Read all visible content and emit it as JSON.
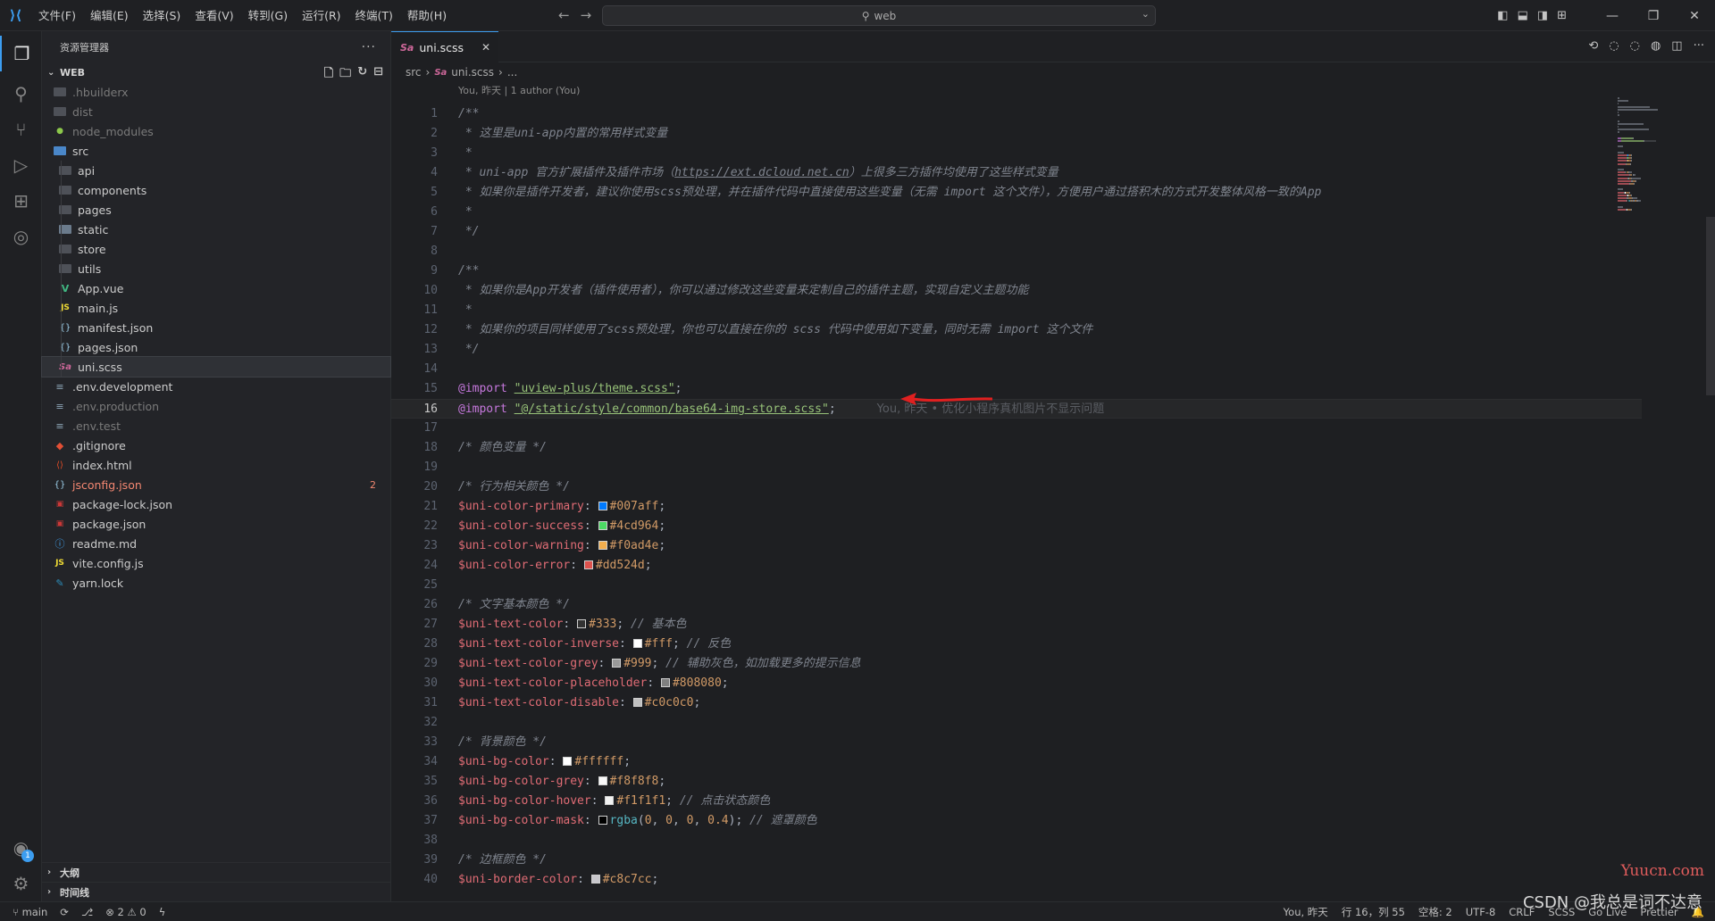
{
  "menu": [
    "文件(F)",
    "编辑(E)",
    "选择(S)",
    "查看(V)",
    "转到(G)",
    "运行(R)",
    "终端(T)",
    "帮助(H)"
  ],
  "command_center": "web",
  "sidebar": {
    "title": "资源管理器",
    "workspace": "WEB",
    "tree": [
      {
        "name": ".hbuilderx",
        "icon": "folder",
        "depth": 0,
        "dim": true
      },
      {
        "name": "dist",
        "icon": "folder",
        "depth": 0,
        "dim": true
      },
      {
        "name": "node_modules",
        "icon": "folder-node",
        "depth": 0,
        "dim": true
      },
      {
        "name": "src",
        "icon": "folder-open-src",
        "depth": 0
      },
      {
        "name": "api",
        "icon": "folder",
        "depth": 1
      },
      {
        "name": "components",
        "icon": "folder",
        "depth": 1
      },
      {
        "name": "pages",
        "icon": "folder",
        "depth": 1
      },
      {
        "name": "static",
        "icon": "folder-static",
        "depth": 1
      },
      {
        "name": "store",
        "icon": "folder",
        "depth": 1
      },
      {
        "name": "utils",
        "icon": "folder",
        "depth": 1
      },
      {
        "name": "App.vue",
        "icon": "vue-icon",
        "depth": 1
      },
      {
        "name": "main.js",
        "icon": "js-icon",
        "depth": 1
      },
      {
        "name": "manifest.json",
        "icon": "json-icon",
        "depth": 1
      },
      {
        "name": "pages.json",
        "icon": "json-icon",
        "depth": 1
      },
      {
        "name": "uni.scss",
        "icon": "sass-icon",
        "depth": 1,
        "selected": true
      },
      {
        "name": ".env.development",
        "icon": "env-icon",
        "depth": 0
      },
      {
        "name": ".env.production",
        "icon": "env-icon",
        "depth": 0,
        "dim": true
      },
      {
        "name": ".env.test",
        "icon": "env-icon",
        "depth": 0,
        "dim": true
      },
      {
        "name": ".gitignore",
        "icon": "git-icon",
        "depth": 0
      },
      {
        "name": "index.html",
        "icon": "html-icon",
        "depth": 0
      },
      {
        "name": "jsconfig.json",
        "icon": "json-icon",
        "depth": 0,
        "red": true,
        "badge": "2"
      },
      {
        "name": "package-lock.json",
        "icon": "npm-icon",
        "depth": 0
      },
      {
        "name": "package.json",
        "icon": "npm-icon",
        "depth": 0
      },
      {
        "name": "readme.md",
        "icon": "info-icon",
        "depth": 0
      },
      {
        "name": "vite.config.js",
        "icon": "js-icon",
        "depth": 0
      },
      {
        "name": "yarn.lock",
        "icon": "yarn-icon",
        "depth": 0
      }
    ],
    "outline_label": "大纲",
    "timeline_label": "时间线"
  },
  "editor": {
    "tab_label": "uni.scss",
    "breadcrumb": [
      "src",
      "uni.scss",
      "..."
    ],
    "blame_header": "You, 昨天 | 1 author (You)",
    "inline_blame": "You, 昨天 • 优化小程序真机图片不显示问题",
    "current_line": 16
  },
  "colors": {
    "primary": "#007aff",
    "success": "#4cd964",
    "warning": "#f0ad4e",
    "error": "#dd524d",
    "text": "#333",
    "inverse": "#fff",
    "grey": "#999",
    "placeholder": "#808080",
    "disable": "#c0c0c0",
    "bg": "#ffffff",
    "bg_grey": "#f8f8f8",
    "bg_hover": "#f1f1f1",
    "bg_mask": "#000000",
    "border": "#c8c7cc"
  },
  "code_lines": [
    [
      {
        "c": "t-comment",
        "t": "/**"
      }
    ],
    [
      {
        "c": "t-comment",
        "t": " * 这里是uni-app内置的常用样式变量"
      }
    ],
    [
      {
        "c": "t-comment",
        "t": " *"
      }
    ],
    [
      {
        "c": "t-comment",
        "t": " * uni-app 官方扩展插件及插件市场（"
      },
      {
        "c": "t-link",
        "t": "https://ext.dcloud.net.cn"
      },
      {
        "c": "t-comment",
        "t": "）上很多三方插件均使用了这些样式变量"
      }
    ],
    [
      {
        "c": "t-comment",
        "t": " * 如果你是插件开发者，建议你使用scss预处理，并在插件代码中直接使用这些变量（无需 import 这个文件），方便用户通过搭积木的方式开发整体风格一致的App"
      }
    ],
    [
      {
        "c": "t-comment",
        "t": " *"
      }
    ],
    [
      {
        "c": "t-comment",
        "t": " */"
      }
    ],
    [],
    [
      {
        "c": "t-comment",
        "t": "/**"
      }
    ],
    [
      {
        "c": "t-comment",
        "t": " * 如果你是App开发者（插件使用者），你可以通过修改这些变量来定制自己的插件主题，实现自定义主题功能"
      }
    ],
    [
      {
        "c": "t-comment",
        "t": " *"
      }
    ],
    [
      {
        "c": "t-comment",
        "t": " * 如果你的项目同样使用了scss预处理，你也可以直接在你的 scss 代码中使用如下变量，同时无需 import 这个文件"
      }
    ],
    [
      {
        "c": "t-comment",
        "t": " */"
      }
    ],
    [],
    [
      {
        "c": "t-kw",
        "t": "@import"
      },
      {
        "c": "t-plain",
        "t": " "
      },
      {
        "c": "t-str",
        "t": "\"uview-plus/theme.scss\""
      },
      {
        "c": "t-plain",
        "t": ";"
      }
    ],
    [
      {
        "c": "t-kw",
        "t": "@import"
      },
      {
        "c": "t-plain",
        "t": " "
      },
      {
        "c": "t-str",
        "t": "\"@/static/style/common/base64-img-store.scss\""
      },
      {
        "c": "t-plain",
        "t": ";"
      },
      {
        "c": "blame-inline",
        "t": "You, 昨天 • 优化小程序真机图片不显示问题"
      }
    ],
    [],
    [
      {
        "c": "t-comment",
        "t": "/* 颜色变量 */"
      }
    ],
    [],
    [
      {
        "c": "t-comment",
        "t": "/* 行为相关颜色 */"
      }
    ],
    [
      {
        "c": "t-var",
        "t": "$uni-color-primary"
      },
      {
        "c": "t-plain",
        "t": ": "
      },
      {
        "sw": "#007aff"
      },
      {
        "c": "t-num",
        "t": "#007aff"
      },
      {
        "c": "t-plain",
        "t": ";"
      }
    ],
    [
      {
        "c": "t-var",
        "t": "$uni-color-success"
      },
      {
        "c": "t-plain",
        "t": ": "
      },
      {
        "sw": "#4cd964"
      },
      {
        "c": "t-num",
        "t": "#4cd964"
      },
      {
        "c": "t-plain",
        "t": ";"
      }
    ],
    [
      {
        "c": "t-var",
        "t": "$uni-color-warning"
      },
      {
        "c": "t-plain",
        "t": ": "
      },
      {
        "sw": "#f0ad4e"
      },
      {
        "c": "t-num",
        "t": "#f0ad4e"
      },
      {
        "c": "t-plain",
        "t": ";"
      }
    ],
    [
      {
        "c": "t-var",
        "t": "$uni-color-error"
      },
      {
        "c": "t-plain",
        "t": ": "
      },
      {
        "sw": "#dd524d"
      },
      {
        "c": "t-num",
        "t": "#dd524d"
      },
      {
        "c": "t-plain",
        "t": ";"
      }
    ],
    [],
    [
      {
        "c": "t-comment",
        "t": "/* 文字基本颜色 */"
      }
    ],
    [
      {
        "c": "t-var",
        "t": "$uni-text-color"
      },
      {
        "c": "t-plain",
        "t": ": "
      },
      {
        "sw": "#333"
      },
      {
        "c": "t-num",
        "t": "#333"
      },
      {
        "c": "t-plain",
        "t": "; "
      },
      {
        "c": "t-comment",
        "t": "// 基本色"
      }
    ],
    [
      {
        "c": "t-var",
        "t": "$uni-text-color-inverse"
      },
      {
        "c": "t-plain",
        "t": ": "
      },
      {
        "sw": "#fff"
      },
      {
        "c": "t-num",
        "t": "#fff"
      },
      {
        "c": "t-plain",
        "t": "; "
      },
      {
        "c": "t-comment",
        "t": "// 反色"
      }
    ],
    [
      {
        "c": "t-var",
        "t": "$uni-text-color-grey"
      },
      {
        "c": "t-plain",
        "t": ": "
      },
      {
        "sw": "#999"
      },
      {
        "c": "t-num",
        "t": "#999"
      },
      {
        "c": "t-plain",
        "t": "; "
      },
      {
        "c": "t-comment",
        "t": "// 辅助灰色，如加载更多的提示信息"
      }
    ],
    [
      {
        "c": "t-var",
        "t": "$uni-text-color-placeholder"
      },
      {
        "c": "t-plain",
        "t": ": "
      },
      {
        "sw": "#808080"
      },
      {
        "c": "t-num",
        "t": "#808080"
      },
      {
        "c": "t-plain",
        "t": ";"
      }
    ],
    [
      {
        "c": "t-var",
        "t": "$uni-text-color-disable"
      },
      {
        "c": "t-plain",
        "t": ": "
      },
      {
        "sw": "#c0c0c0"
      },
      {
        "c": "t-num",
        "t": "#c0c0c0"
      },
      {
        "c": "t-plain",
        "t": ";"
      }
    ],
    [],
    [
      {
        "c": "t-comment",
        "t": "/* 背景颜色 */"
      }
    ],
    [
      {
        "c": "t-var",
        "t": "$uni-bg-color"
      },
      {
        "c": "t-plain",
        "t": ": "
      },
      {
        "sw": "#ffffff"
      },
      {
        "c": "t-num",
        "t": "#ffffff"
      },
      {
        "c": "t-plain",
        "t": ";"
      }
    ],
    [
      {
        "c": "t-var",
        "t": "$uni-bg-color-grey"
      },
      {
        "c": "t-plain",
        "t": ": "
      },
      {
        "sw": "#f8f8f8"
      },
      {
        "c": "t-num",
        "t": "#f8f8f8"
      },
      {
        "c": "t-plain",
        "t": ";"
      }
    ],
    [
      {
        "c": "t-var",
        "t": "$uni-bg-color-hover"
      },
      {
        "c": "t-plain",
        "t": ": "
      },
      {
        "sw": "#f1f1f1"
      },
      {
        "c": "t-num",
        "t": "#f1f1f1"
      },
      {
        "c": "t-plain",
        "t": "; "
      },
      {
        "c": "t-comment",
        "t": "// 点击状态颜色"
      }
    ],
    [
      {
        "c": "t-var",
        "t": "$uni-bg-color-mask"
      },
      {
        "c": "t-plain",
        "t": ": "
      },
      {
        "sw": "#000000"
      },
      {
        "c": "t-fn",
        "t": "rgba"
      },
      {
        "c": "t-plain",
        "t": "("
      },
      {
        "c": "t-num",
        "t": "0"
      },
      {
        "c": "t-plain",
        "t": ", "
      },
      {
        "c": "t-num",
        "t": "0"
      },
      {
        "c": "t-plain",
        "t": ", "
      },
      {
        "c": "t-num",
        "t": "0"
      },
      {
        "c": "t-plain",
        "t": ", "
      },
      {
        "c": "t-num",
        "t": "0.4"
      },
      {
        "c": "t-plain",
        "t": "); "
      },
      {
        "c": "t-comment",
        "t": "// 遮罩颜色"
      }
    ],
    [],
    [
      {
        "c": "t-comment",
        "t": "/* 边框颜色 */"
      }
    ],
    [
      {
        "c": "t-var",
        "t": "$uni-border-color"
      },
      {
        "c": "t-plain",
        "t": ": "
      },
      {
        "sw": "#c8c7cc"
      },
      {
        "c": "t-num",
        "t": "#c8c7cc"
      },
      {
        "c": "t-plain",
        "t": ";"
      }
    ],
    []
  ],
  "statusbar": {
    "branch": "main",
    "problems": "⊗ 2 ⚠ 0",
    "blame": "You, 昨天",
    "position": "行 16，列 55",
    "spaces": "空格: 2",
    "encoding": "UTF-8",
    "eol": "CRLF",
    "language": "SCSS",
    "golive": "Go Live",
    "prettier": "Prettier"
  },
  "watermark": "CSDN @我总是词不达意",
  "watermark2": "Yuucn.com"
}
